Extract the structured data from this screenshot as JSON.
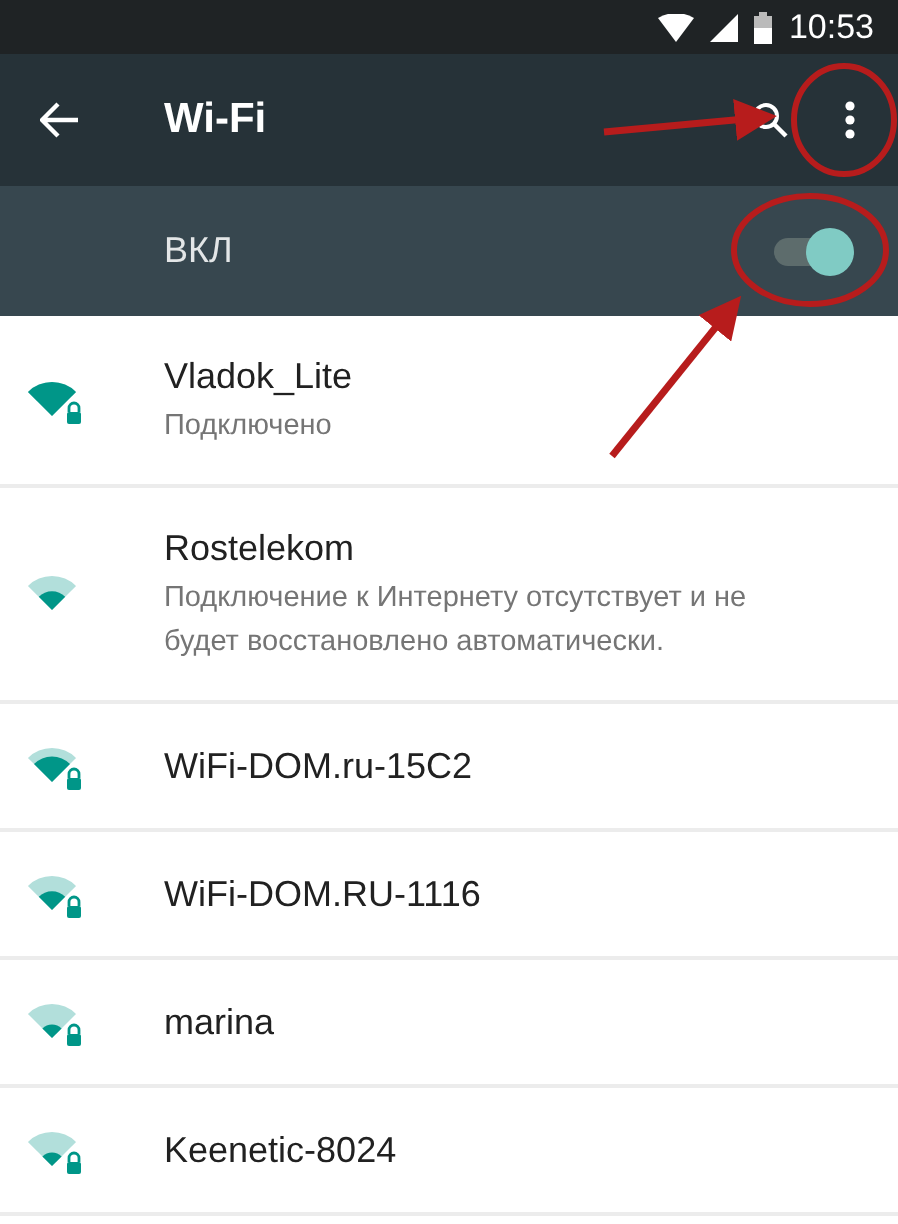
{
  "status_bar": {
    "time": "10:53"
  },
  "toolbar": {
    "title": "Wi-Fi"
  },
  "master_switch": {
    "label": "ВКЛ",
    "on": true
  },
  "networks": [
    {
      "name": "Vladok_Lite",
      "status": "Подключено",
      "kind": "full",
      "secured": true
    },
    {
      "name": "Rostelekom",
      "status": "Подключение к Интернету отсутствует и не будет восстановлено автоматически.",
      "kind": "medium",
      "secured": false
    },
    {
      "name": "WiFi-DOM.ru-15C2",
      "kind": "high",
      "secured": true
    },
    {
      "name": "WiFi-DOM.RU-1116",
      "kind": "medium",
      "secured": true
    },
    {
      "name": "marina",
      "kind": "low",
      "secured": true
    },
    {
      "name": "Keenetic-8024",
      "kind": "low",
      "secured": true
    }
  ]
}
